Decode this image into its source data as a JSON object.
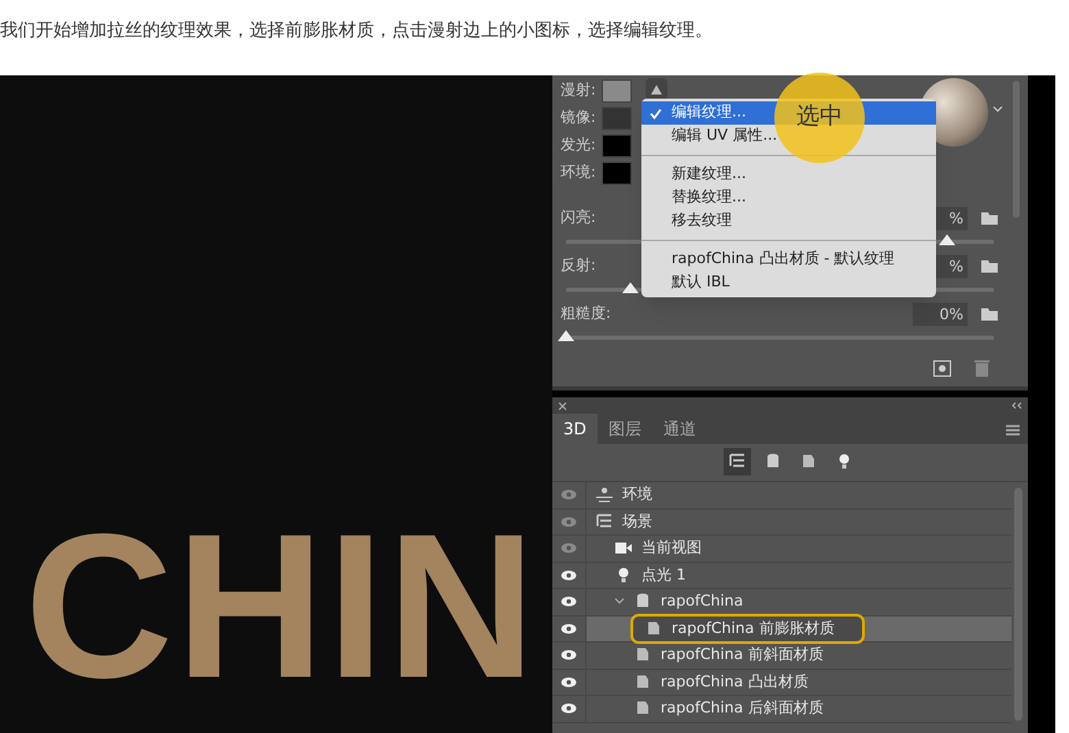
{
  "caption": "我们开始增加拉丝的纹理效果，选择前膨胀材质，点击漫射边上的小图标，选择编辑纹理。",
  "canvas_text": "CHIN",
  "properties": {
    "color_rows": [
      {
        "label": "漫射:",
        "color": "#8a8a8a"
      },
      {
        "label": "镜像:",
        "color": "#333333"
      },
      {
        "label": "发光:",
        "color": "#000000"
      },
      {
        "label": "环境:",
        "color": "#000000"
      }
    ],
    "sliders": [
      {
        "label": "闪亮:",
        "value": "%",
        "level": 0.89
      },
      {
        "label": "反射:",
        "value": "%",
        "level": 0.15
      },
      {
        "label": "粗糙度:",
        "value": "0%",
        "level": 0
      }
    ]
  },
  "menu": {
    "groups": [
      [
        {
          "label": "编辑纹理...",
          "selected": true
        },
        {
          "label": "编辑 UV 属性...",
          "selected": false
        }
      ],
      [
        {
          "label": "新建纹理...",
          "selected": false
        },
        {
          "label": "替换纹理...",
          "selected": false
        },
        {
          "label": "移去纹理",
          "selected": false
        }
      ],
      [
        {
          "label": "rapofChina 凸出材质 - 默认纹理",
          "selected": false
        },
        {
          "label": "默认 IBL",
          "selected": false
        }
      ]
    ]
  },
  "callout": "选中",
  "panel_3d": {
    "tabs": [
      {
        "label": "3D",
        "selected": true
      },
      {
        "label": "图层",
        "selected": false
      },
      {
        "label": "通道",
        "selected": false
      }
    ],
    "tools": [
      {
        "kind": "scene",
        "selected": true
      },
      {
        "kind": "mesh",
        "selected": false
      },
      {
        "kind": "material",
        "selected": false
      },
      {
        "kind": "light",
        "selected": false
      }
    ],
    "tree": [
      {
        "label": "环境",
        "kind": "environment",
        "visible": false,
        "selected": false
      },
      {
        "label": "场景",
        "kind": "scene",
        "visible": false,
        "selected": false,
        "children": [
          {
            "label": "当前视图",
            "kind": "camera",
            "visible": false,
            "selected": false
          },
          {
            "label": "点光 1",
            "kind": "light",
            "visible": true,
            "selected": false
          },
          {
            "label": "rapofChina",
            "kind": "mesh",
            "visible": true,
            "selected": false,
            "expanded": true,
            "children": [
              {
                "label": "rapofChina 前膨胀材质",
                "kind": "material",
                "visible": true,
                "selected": true
              },
              {
                "label": "rapofChina 前斜面材质",
                "kind": "material",
                "visible": true,
                "selected": false
              },
              {
                "label": "rapofChina 凸出材质",
                "kind": "material",
                "visible": true,
                "selected": false
              },
              {
                "label": "rapofChina 后斜面材质",
                "kind": "material",
                "visible": true,
                "selected": false
              }
            ]
          }
        ]
      }
    ]
  }
}
